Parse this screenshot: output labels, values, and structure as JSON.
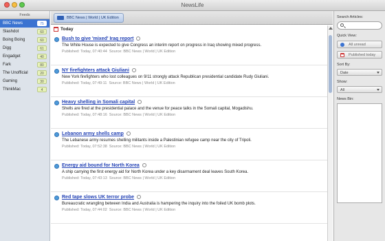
{
  "window": {
    "title": "NewsLife"
  },
  "sidebar": {
    "header": "Feeds",
    "feeds": [
      {
        "label": "BBC News",
        "count": "75",
        "selected": true
      },
      {
        "label": "Slashdot",
        "count": "60"
      },
      {
        "label": "Boing Boing",
        "count": "60"
      },
      {
        "label": "Digg",
        "count": "61"
      },
      {
        "label": "Engadget",
        "count": "40"
      },
      {
        "label": "Fark",
        "count": "80"
      },
      {
        "label": "The Unofficial",
        "count": "20"
      },
      {
        "label": "Gaming",
        "count": "30"
      },
      {
        "label": "ThinkMac",
        "count": "4"
      }
    ]
  },
  "tab": {
    "label": "BBC News | World | UK Edition"
  },
  "main": {
    "section": "Today",
    "articles": [
      {
        "title": "Bush to give 'mixed' Iraq report",
        "description": "The White House is expected to give Congress an interim report on progress in Iraq showing mixed progress.",
        "published": "Published: Today, 07:40:44",
        "source": "Source: BBC News | World | UK Edition"
      },
      {
        "title": "NY firefighters attack Giuliani",
        "description": "New York firefighters who lost colleagues on 9/11 strongly attack Republican presidential candidate Rudy Giuliani.",
        "published": "Published: Today, 07:49:11",
        "source": "Source: BBC News | World | UK Edition"
      },
      {
        "title": "Heavy shelling in Somali capital",
        "description": "Shells are fired at the presidential palace and the venue for peace talks in the Somali capital, Mogadishu.",
        "published": "Published: Today, 07:48:16",
        "source": "Source: BBC News | World | UK Edition"
      },
      {
        "title": "Lebanon army shells camp",
        "description": "The Lebanese army resumes shelling militants inside a Palestinian refugee camp near the city of Tripoli.",
        "published": "Published: Today, 07:52:38",
        "source": "Source: BBC News | World | UK Edition"
      },
      {
        "title": "Energy aid bound for North Korea",
        "description": "A ship carrying the first energy aid for North Korea under a key disarmament deal leaves South Korea.",
        "published": "Published: Today, 07:43:13",
        "source": "Source: BBC News | World | UK Edition"
      },
      {
        "title": "Red tape slows UK terror probe",
        "description": "Bureaucratic wrangling between India and Australia is hampering the inquiry into the foiled UK bomb plots.",
        "published": "Published: Today, 07:44:02",
        "source": "Source: BBC News | World | UK Edition"
      }
    ]
  },
  "right_panel": {
    "search_label": "Search Articles:",
    "quick_view_label": "Quick View:",
    "all_unread": "All unread",
    "published_today": "Published today",
    "sort_by_label": "Sort By:",
    "sort_by_value": "Date",
    "show_label": "Show:",
    "show_value": "All",
    "news_bin_label": "News Bin:"
  }
}
